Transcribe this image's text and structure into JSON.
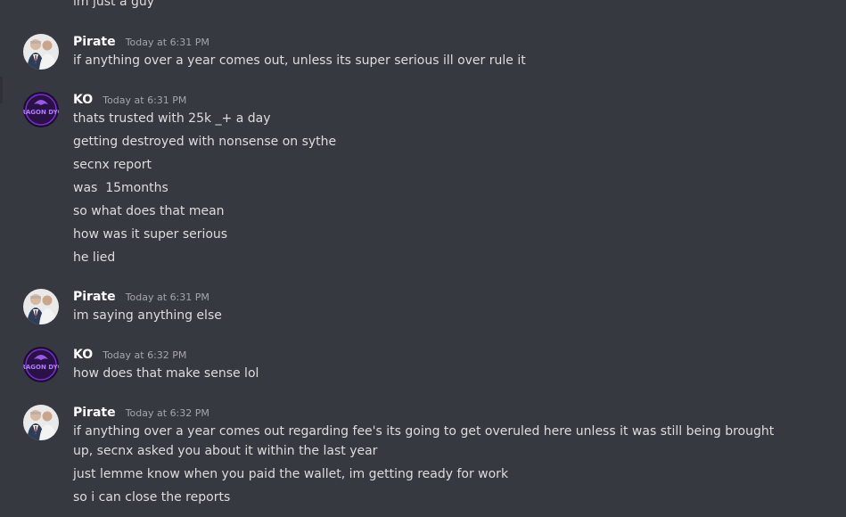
{
  "previous_message": {
    "text": "im just a guy"
  },
  "groups": [
    {
      "username": "Pirate",
      "timestamp": "Today at 6:31 PM",
      "messages": [
        "if anything over a year comes out, unless its super serious ill over rule it"
      ]
    },
    {
      "username": "KO",
      "timestamp": "Today at 6:31 PM",
      "avatar_text": "DRAGON DYCE",
      "messages": [
        "thats trusted with 25k _+ a day",
        "getting destroyed with nonsense on sythe",
        "secnx report",
        "was  15months",
        "so what does that mean",
        "how was it super serious",
        "he lied"
      ]
    },
    {
      "username": "Pirate",
      "timestamp": "Today at 6:31 PM",
      "messages": [
        "im saying anything else"
      ]
    },
    {
      "username": "KO",
      "timestamp": "Today at 6:32 PM",
      "avatar_text": "DRAGON DYCE",
      "messages": [
        "how does that make sense lol"
      ]
    },
    {
      "username": "Pirate",
      "timestamp": "Today at 6:32 PM",
      "messages": [
        "if anything over a year comes out regarding fee's its going to get overuled here unless it was still being brought up, secnx asked you about it within the last year",
        "just lemme know when you paid the wallet, im getting ready for work",
        "so i can close the reports"
      ]
    }
  ],
  "colors": {
    "background": "#36393f",
    "username": "#ffffff",
    "timestamp": "#a3a6aa",
    "message_text": "#dcddde",
    "ko_avatar_accent": "#7b2fd6"
  }
}
